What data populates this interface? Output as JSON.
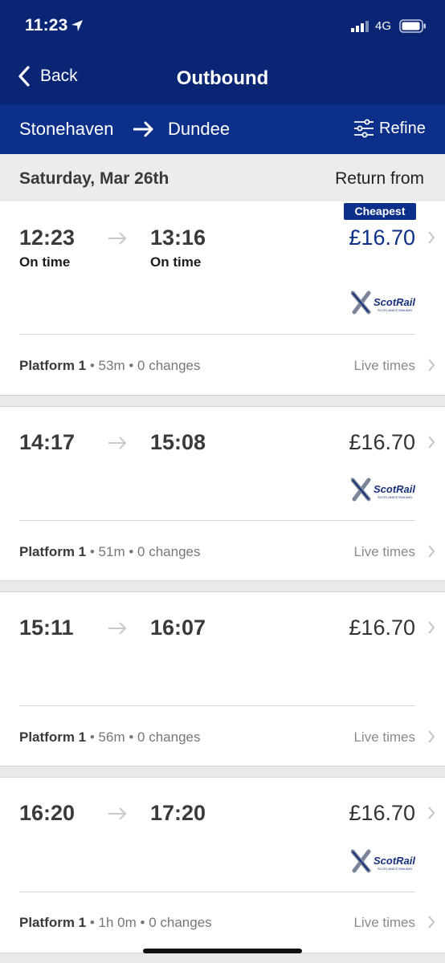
{
  "status_bar": {
    "time": "11:23",
    "network": "4G"
  },
  "nav": {
    "back_label": "Back",
    "title": "Outbound"
  },
  "route": {
    "from": "Stonehaven",
    "to": "Dundee",
    "refine_label": "Refine"
  },
  "date_bar": {
    "date": "Saturday, Mar 26th",
    "return_label": "Return from"
  },
  "journeys": [
    {
      "depart": "12:23",
      "arrive": "13:16",
      "depart_status": "On time",
      "arrive_status": "On time",
      "price": "£16.70",
      "badge": "Cheapest",
      "operator": "ScotRail",
      "operator_tagline": "SCOTLAND'S RAILWAY",
      "platform": "Platform 1",
      "duration": "53m",
      "changes": "0 changes",
      "live_label": "Live times"
    },
    {
      "depart": "14:17",
      "arrive": "15:08",
      "price": "£16.70",
      "operator": "ScotRail",
      "operator_tagline": "SCOTLAND'S RAILWAY",
      "platform": "Platform 1",
      "duration": "51m",
      "changes": "0 changes",
      "live_label": "Live times"
    },
    {
      "depart": "15:11",
      "arrive": "16:07",
      "price": "£16.70",
      "platform": "Platform 1",
      "duration": "56m",
      "changes": "0 changes",
      "live_label": "Live times"
    },
    {
      "depart": "16:20",
      "arrive": "17:20",
      "price": "£16.70",
      "operator": "ScotRail",
      "operator_tagline": "SCOTLAND'S RAILWAY",
      "platform": "Platform 1",
      "duration": "1h 0m",
      "changes": "0 changes",
      "live_label": "Live times"
    }
  ],
  "colors": {
    "header": "#0b2575",
    "route_bar": "#0c2f8a",
    "cheapest_price": "#0c2f8a"
  },
  "icons": [
    "location-arrow-icon",
    "signal-icon",
    "battery-icon",
    "chevron-left-icon",
    "arrow-right-icon",
    "sliders-icon",
    "chevron-right-icon"
  ]
}
